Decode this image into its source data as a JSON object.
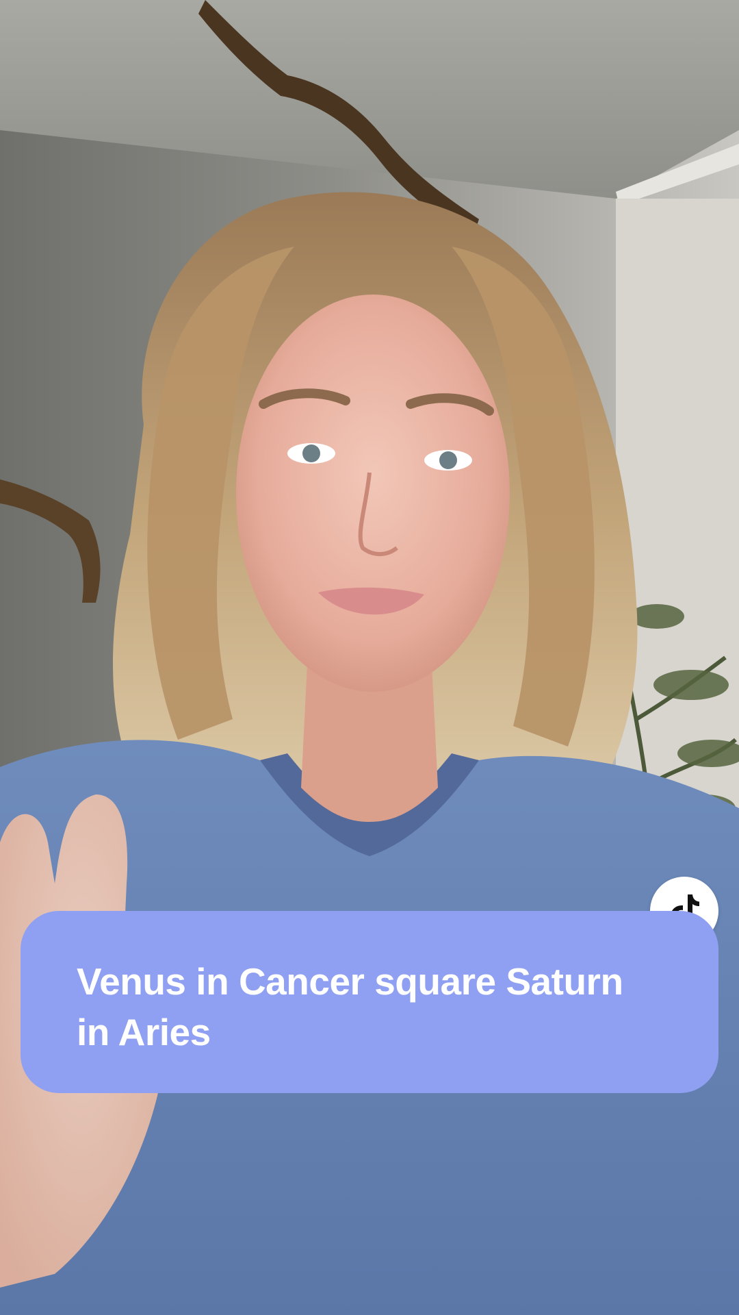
{
  "video": {
    "scene": "person-talking-to-camera"
  },
  "caption": {
    "text": "Venus in Cancer square Saturn in Aries",
    "background_color": "#8fa0f2",
    "text_color": "#ffffff"
  },
  "badge": {
    "icon": "tiktok-logo-icon",
    "background_color": "#ffffff",
    "icon_color": "#111111"
  }
}
